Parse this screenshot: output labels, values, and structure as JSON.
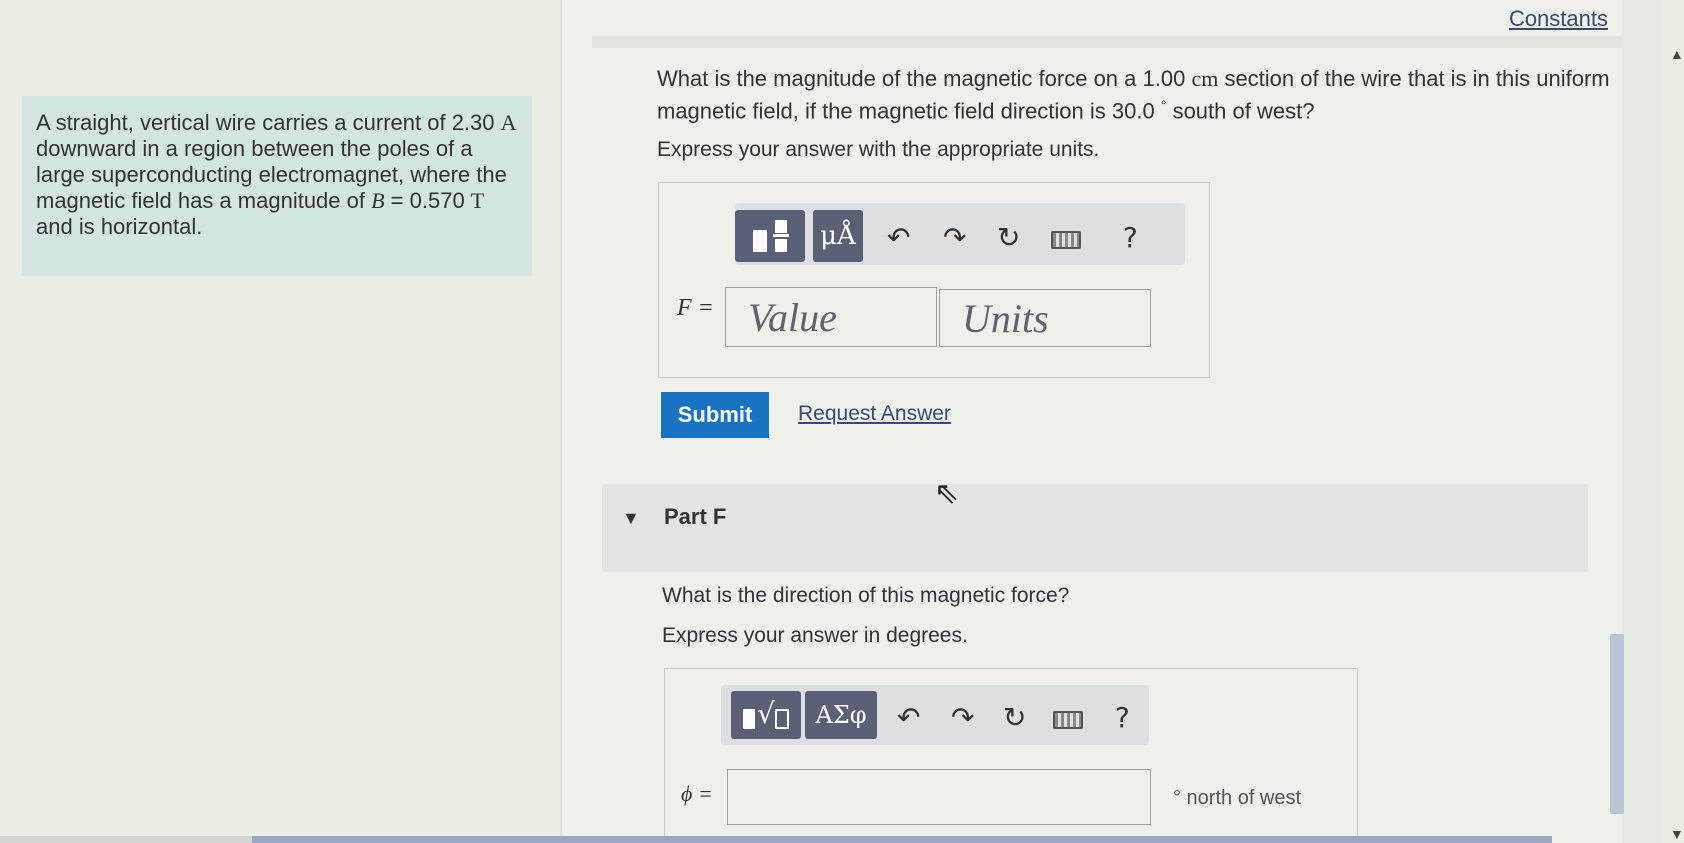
{
  "header": {
    "constants_label": "Constants"
  },
  "problem": {
    "text_parts": [
      "A straight, vertical wire carries a current of 2.30  ",
      "A",
      " downward in a region between the poles of a large superconducting electromagnet, where the magnetic field has a magnitude of ",
      "B",
      " = 0.570  ",
      "T",
      " and is horizontal."
    ]
  },
  "part_e": {
    "question_a": "What is the magnitude of the magnetic force on a 1.00 ",
    "question_unit": "cm",
    "question_b": " section of the wire that is in this uniform magnetic field, if the magnetic field direction is 30.0",
    "question_deg": "°",
    "question_c": " south of west?",
    "instruction": "Express your answer with the appropriate units.",
    "toolbar": {
      "units_button": "μÅ",
      "undo": "↶",
      "redo": "↷",
      "reset": "↻",
      "help": "?"
    },
    "variable_label": "F =",
    "value_placeholder": "Value",
    "units_placeholder": "Units",
    "submit_label": "Submit",
    "request_label": "Request Answer"
  },
  "part_f": {
    "header": "Part F",
    "question": "What is the direction of this magnetic force?",
    "instruction": "Express your answer in degrees.",
    "toolbar": {
      "greek_button": "ΑΣφ",
      "undo": "↶",
      "redo": "↷",
      "reset": "↻",
      "help": "?"
    },
    "variable_label": "ϕ =",
    "answer_value": "",
    "suffix": "° north of west"
  }
}
